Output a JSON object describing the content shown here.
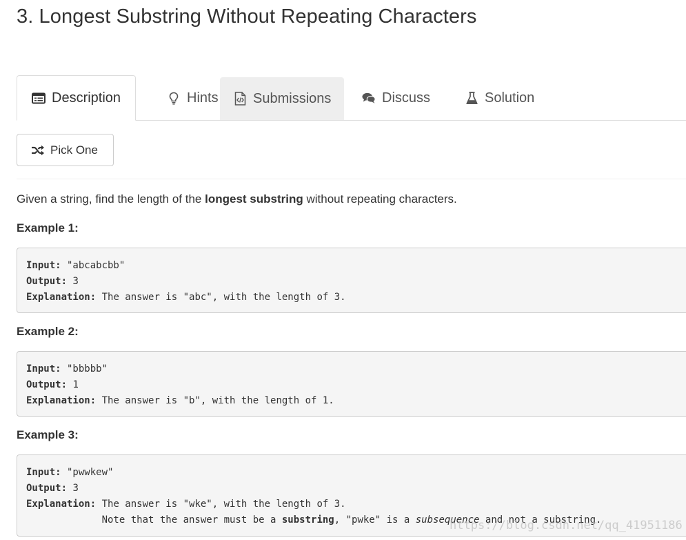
{
  "problem": {
    "title": "3. Longest Substring Without Repeating Characters"
  },
  "tabs": [
    {
      "label": "Description",
      "icon": "description-icon",
      "active": true
    },
    {
      "label": "Hints",
      "icon": "lightbulb-icon",
      "active": false
    },
    {
      "label": "Submissions",
      "icon": "code-file-icon",
      "active": false
    },
    {
      "label": "Discuss",
      "icon": "chat-bubbles-icon",
      "active": false
    },
    {
      "label": "Solution",
      "icon": "flask-icon",
      "active": false
    }
  ],
  "pick_one": {
    "label": "Pick One",
    "icon": "shuffle-icon"
  },
  "description": {
    "intro_before": "Given a string, find the length of the ",
    "intro_bold": "longest substring",
    "intro_after": " without repeating characters."
  },
  "examples": [
    {
      "heading": "Example 1:",
      "input_label": "Input:",
      "input_value": " \"abcabcbb\"",
      "output_label": "Output:",
      "output_value": " 3",
      "explanation_label": "Explanation:",
      "explanation_value": " The answer is \"abc\", with the length of 3."
    },
    {
      "heading": "Example 2:",
      "input_label": "Input:",
      "input_value": " \"bbbbb\"",
      "output_label": "Output:",
      "output_value": " 1",
      "explanation_label": "Explanation:",
      "explanation_value": " The answer is \"b\", with the length of 1."
    },
    {
      "heading": "Example 3:",
      "input_label": "Input:",
      "input_value": " \"pwwkew\"",
      "output_label": "Output:",
      "output_value": " 3",
      "explanation_label": "Explanation:",
      "explanation_value": " The answer is \"wke\", with the length of 3.",
      "note_prefix": "             Note that the answer must be a ",
      "note_bold": "substring",
      "note_mid": ", \"pwke\" is a ",
      "note_italic": "subsequence",
      "note_suffix": " and not a substring."
    }
  ],
  "watermark": "https://blog.csdn.net/qq_41951186",
  "colors": {
    "text": "#333333",
    "tab_inactive_text": "#555555",
    "code_background": "#f5f5f5",
    "border": "#dddddd",
    "tab_hover_background": "#eeeeee"
  }
}
